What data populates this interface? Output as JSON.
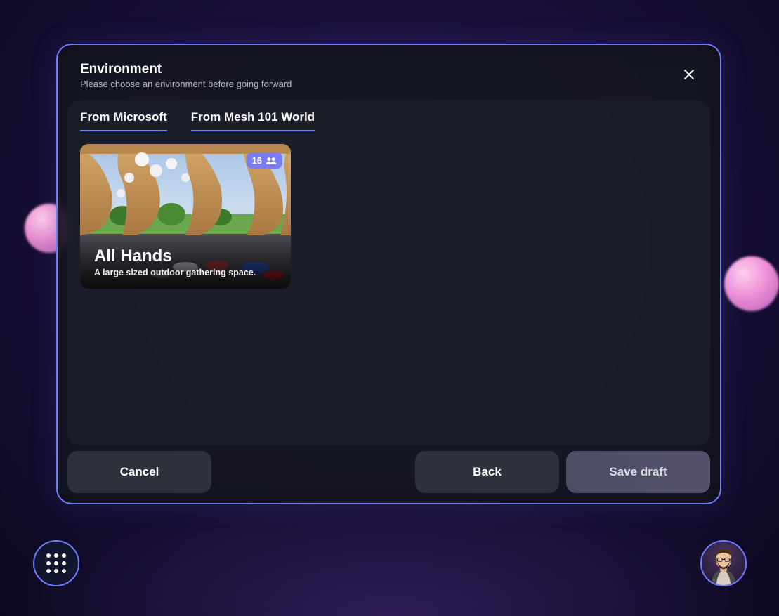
{
  "modal": {
    "title": "Environment",
    "subtitle": "Please choose an environment before going forward"
  },
  "tabs": {
    "from_microsoft": "From Microsoft",
    "from_mesh": "From Mesh 101 World"
  },
  "card": {
    "title": "All Hands",
    "description": "A large sized outdoor gathering space.",
    "capacity": "16"
  },
  "buttons": {
    "cancel": "Cancel",
    "back": "Back",
    "save_draft": "Save draft"
  }
}
